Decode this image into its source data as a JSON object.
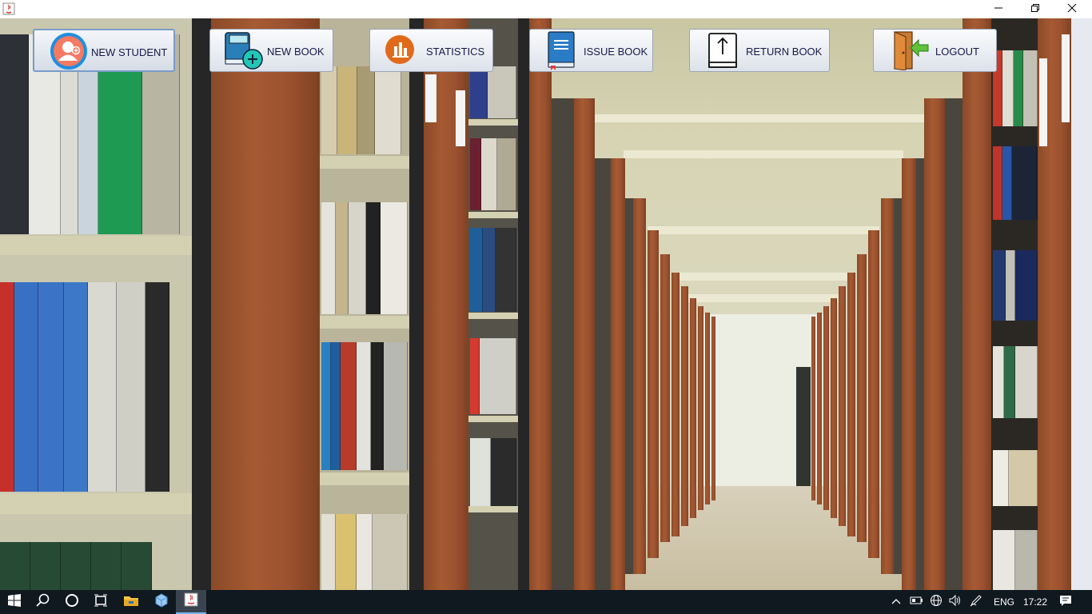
{
  "window": {
    "title": "",
    "controls": {
      "minimize_icon": "minimize-icon",
      "maximize_icon": "restore-icon",
      "close_icon": "close-icon"
    }
  },
  "toolbar": {
    "buttons": [
      {
        "label": "NEW STUDENT",
        "icon": "student-add-icon",
        "selected": true
      },
      {
        "label": "NEW BOOK",
        "icon": "book-add-icon",
        "selected": false
      },
      {
        "label": "STATISTICS",
        "icon": "chart-icon",
        "selected": false
      },
      {
        "label": "ISSUE BOOK",
        "icon": "issue-book-icon",
        "selected": false
      },
      {
        "label": "RETURN BOOK",
        "icon": "return-book-icon",
        "selected": false
      },
      {
        "label": "LOGOUT",
        "icon": "logout-door-icon",
        "selected": false
      }
    ]
  },
  "background": {
    "description_icon": "library-aisle-image"
  },
  "taskbar": {
    "items": [
      "windows-start-icon",
      "search-icon",
      "cortana-icon",
      "task-view-icon",
      "file-explorer-icon",
      "app-cube-icon",
      "java-app-icon"
    ],
    "tray": {
      "language": "ENG",
      "time": "17:22"
    }
  },
  "colors": {
    "accent": "#7a9cc8",
    "label_text": "#151a4a",
    "taskbar": "#101820"
  }
}
